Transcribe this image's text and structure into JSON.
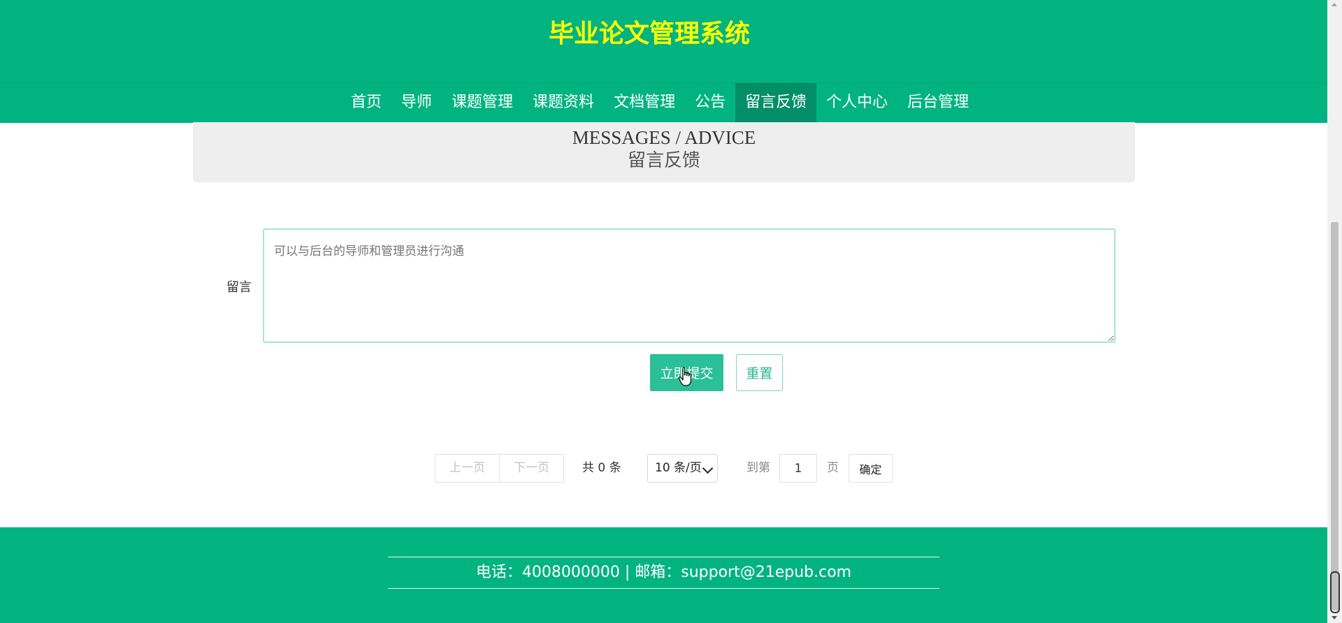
{
  "header": {
    "title": "毕业论文管理系统"
  },
  "nav": {
    "items": [
      {
        "label": "首页"
      },
      {
        "label": "导师"
      },
      {
        "label": "课题管理"
      },
      {
        "label": "课题资料"
      },
      {
        "label": "文档管理"
      },
      {
        "label": "公告"
      },
      {
        "label": "留言反馈",
        "active": true
      },
      {
        "label": "个人中心"
      },
      {
        "label": "后台管理"
      }
    ]
  },
  "banner": {
    "title_en": "MESSAGES / ADVICE",
    "title_cn": "留言反馈"
  },
  "form": {
    "label": "留言",
    "placeholder": "可以与后台的导师和管理员进行沟通",
    "submit_label": "立即提交",
    "reset_label": "重置"
  },
  "pagination": {
    "prev_label": "上一页",
    "next_label": "下一页",
    "total_text": "共 0 条",
    "page_size": "10 条/页",
    "goto_label": "到第",
    "page_value": "1",
    "page_unit": "页",
    "confirm_label": "确定"
  },
  "footer": {
    "contact": "电话：4008000000 | 邮箱：support@21epub.com"
  },
  "colors": {
    "primary": "#02b382",
    "title": "#ffff00",
    "active_nav": "#028e68",
    "button": "#2bc097"
  }
}
